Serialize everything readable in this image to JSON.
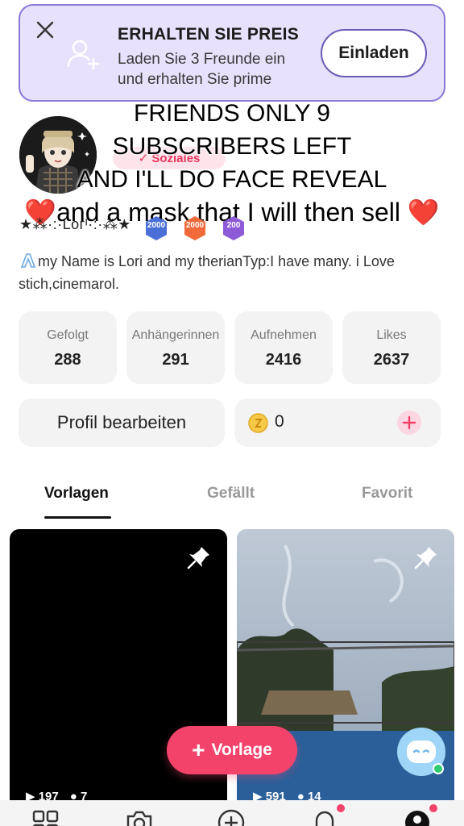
{
  "banner": {
    "title": "ERHALTEN SIE PREIS",
    "subtitle": "Laden Sie 3 Freunde ein und erhalten Sie prime",
    "invite_label": "Einladen"
  },
  "overlay": {
    "line1": "FRIENDS ONLY 9",
    "line2": "SUBSCRIBERS LEFT",
    "line3": "AND I'LL DO FACE REVEAL",
    "line4": "and a mask that I will then sell",
    "heart": "❤️"
  },
  "profile": {
    "social_label": "✓ Soziales",
    "username": "★⁂·:·Lᴏᴦᴵ·:·⁂★",
    "badges": [
      "2000",
      "2000",
      "200"
    ],
    "bio": "my Name is Lori and my therianTyp:I have many. i Love stich,cinemarol."
  },
  "stats": [
    {
      "label": "Gefolgt",
      "value": "288"
    },
    {
      "label": "Anhängerinnen",
      "value": "291"
    },
    {
      "label": "Aufnehmen",
      "value": "2416"
    },
    {
      "label": "Likes",
      "value": "2637"
    }
  ],
  "actions": {
    "edit_label": "Profil bearbeiten",
    "coins": "0"
  },
  "tabs": [
    "Vorlagen",
    "Gefällt",
    "Favorit"
  ],
  "cards": [
    {
      "plays": "197",
      "likes": "7"
    },
    {
      "plays": "591",
      "likes": "14"
    }
  ],
  "fab": {
    "label": "Vorlage"
  },
  "colors": {
    "accent": "#f4436b",
    "banner_bg": "#e7e1fb",
    "banner_border": "#8b78d8"
  }
}
